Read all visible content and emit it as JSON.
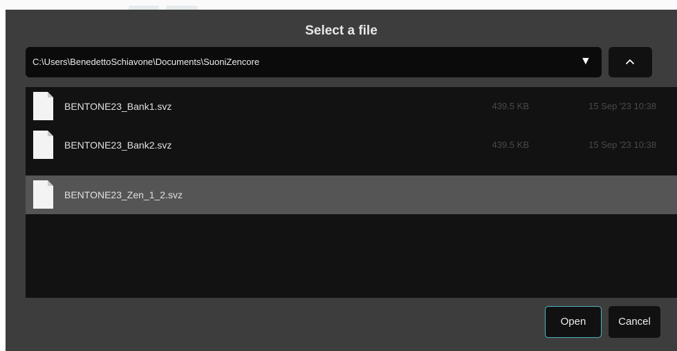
{
  "dialog": {
    "title": "Select a file",
    "path": {
      "value": "C:\\Users\\BenedettoSchiavone\\Documents\\SuoniZencore",
      "dropdown_icon": "triangle-down-icon"
    },
    "up_button": {
      "icon": "chevron-up-icon"
    },
    "files": [
      {
        "name": "BENTONE23_Bank1.svz",
        "size": "439.5 KB",
        "date": "15 Sep '23 10:38",
        "selected": false,
        "icon": "file-icon"
      },
      {
        "name": "BENTONE23_Bank2.svz",
        "size": "439.5 KB",
        "date": "15 Sep '23 10:38",
        "selected": false,
        "icon": "file-icon"
      },
      {
        "name": "BENTONE23_Zen_1_2.svz",
        "size": "",
        "date": "-",
        "selected": true,
        "icon": "file-icon"
      }
    ],
    "buttons": {
      "open_label": "Open",
      "cancel_label": "Cancel"
    }
  },
  "colors": {
    "accent": "#4fb3bf",
    "dialog_background": "#3d3d3d",
    "list_background": "#121212",
    "selected_row": "#555555"
  }
}
